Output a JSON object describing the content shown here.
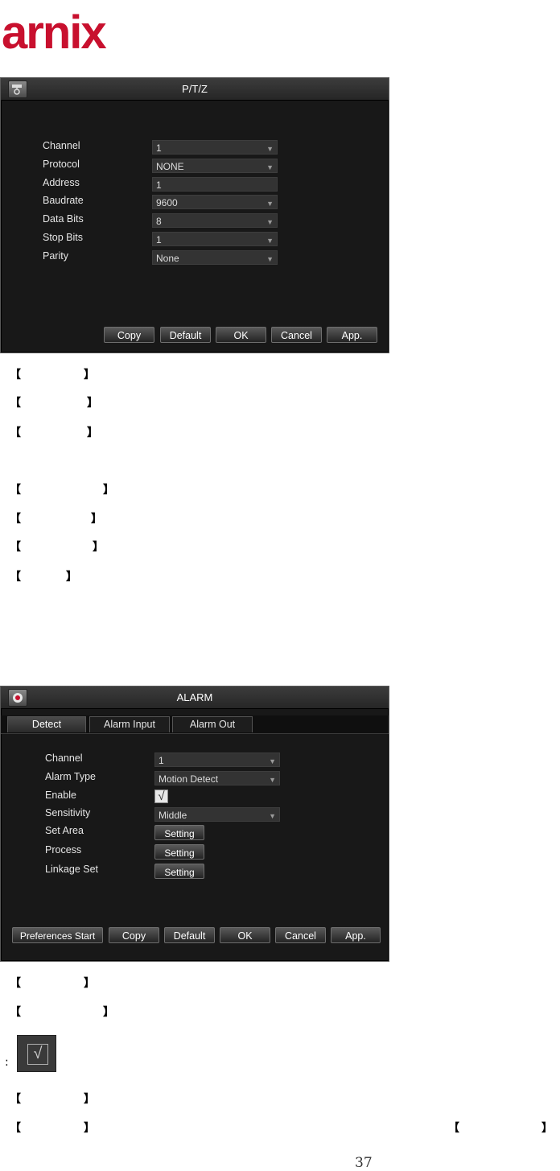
{
  "logo": {
    "text": "arnix",
    "color": "#c8102e"
  },
  "ptz": {
    "title": "P/T/Z",
    "icon": "ptz-camera-icon",
    "fields": [
      {
        "label": "Channel",
        "value": "1",
        "dropdown": true
      },
      {
        "label": "Protocol",
        "value": "NONE",
        "dropdown": true
      },
      {
        "label": "Address",
        "value": "1",
        "dropdown": false
      },
      {
        "label": "Baudrate",
        "value": "9600",
        "dropdown": true
      },
      {
        "label": "Data Bits",
        "value": "8",
        "dropdown": true
      },
      {
        "label": "Stop Bits",
        "value": "1",
        "dropdown": true
      },
      {
        "label": "Parity",
        "value": "None",
        "dropdown": true
      }
    ],
    "buttons": {
      "copy": "Copy",
      "default": "Default",
      "ok": "OK",
      "cancel": "Cancel",
      "apply": "App."
    }
  },
  "alarm": {
    "title": "ALARM",
    "icon": "alarm-bell-icon",
    "tabs": [
      "Detect",
      "Alarm Input",
      "Alarm Out"
    ],
    "active_tab": "Detect",
    "labels": {
      "channel": "Channel",
      "alarm_type": "Alarm Type",
      "enable": "Enable",
      "sensitivity": "Sensitivity",
      "set_area": "Set Area",
      "process": "Process",
      "linkage_set": "Linkage Set"
    },
    "values": {
      "channel": "1",
      "alarm_type": "Motion Detect",
      "enable_checked": "√",
      "sensitivity": "Middle"
    },
    "setting_label": "Setting",
    "buttons": {
      "preferences": "Preferences Start",
      "copy": "Copy",
      "default": "Default",
      "ok": "OK",
      "cancel": "Cancel",
      "apply": "App."
    }
  },
  "doc": {
    "bracket_open": "【",
    "bracket_close": "】",
    "colon": ":",
    "checked_glyph": "√",
    "page_number": "37"
  }
}
